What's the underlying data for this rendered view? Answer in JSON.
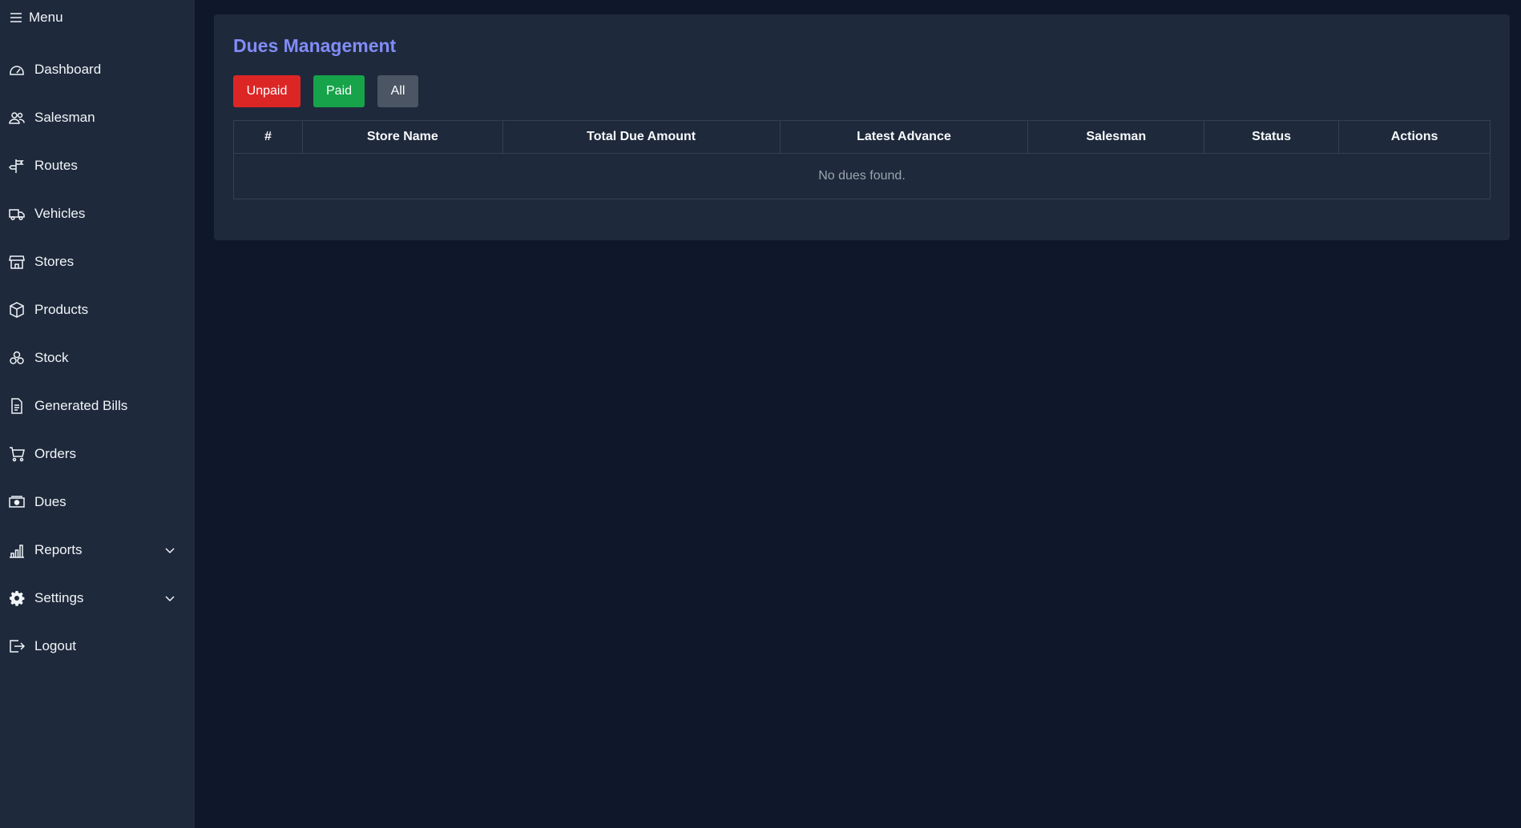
{
  "sidebar": {
    "menu_label": "Menu",
    "items": [
      {
        "label": "Dashboard",
        "icon": "gauge-icon"
      },
      {
        "label": "Salesman",
        "icon": "users-icon"
      },
      {
        "label": "Routes",
        "icon": "signpost-icon"
      },
      {
        "label": "Vehicles",
        "icon": "truck-icon"
      },
      {
        "label": "Stores",
        "icon": "store-icon"
      },
      {
        "label": "Products",
        "icon": "box-icon"
      },
      {
        "label": "Stock",
        "icon": "boxes-icon"
      },
      {
        "label": "Generated Bills",
        "icon": "document-icon"
      },
      {
        "label": "Orders",
        "icon": "cart-icon"
      },
      {
        "label": "Dues",
        "icon": "cash-icon"
      },
      {
        "label": "Reports",
        "icon": "bar-chart-icon",
        "expandable": true
      },
      {
        "label": "Settings",
        "icon": "gear-icon",
        "expandable": true
      },
      {
        "label": "Logout",
        "icon": "logout-icon"
      }
    ]
  },
  "main": {
    "title": "Dues Management",
    "filters": {
      "unpaid": "Unpaid",
      "paid": "Paid",
      "all": "All"
    },
    "table": {
      "columns": [
        "#",
        "Store Name",
        "Total Due Amount",
        "Latest Advance",
        "Salesman",
        "Status",
        "Actions"
      ],
      "empty_message": "No dues found."
    }
  },
  "colors": {
    "background": "#0f172a",
    "panel": "#1e293b",
    "title_accent": "#818cf8",
    "unpaid": "#dc2626",
    "paid": "#16a34a",
    "all": "#4b5563"
  }
}
